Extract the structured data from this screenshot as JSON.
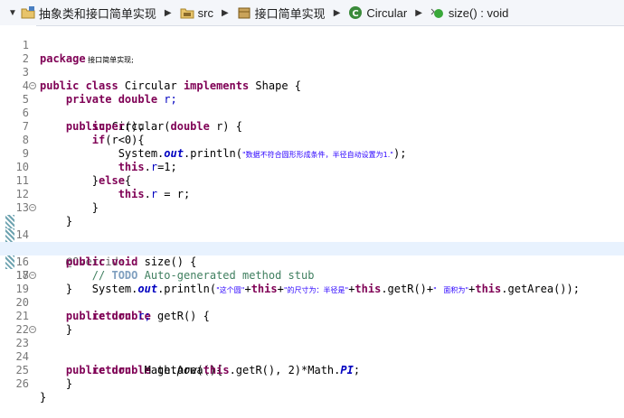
{
  "breadcrumb": {
    "items": [
      {
        "label": "抽象类和接口简单实现",
        "icon": "project-icon"
      },
      {
        "label": "src",
        "icon": "source-folder-icon"
      },
      {
        "label": "接口简单实现",
        "icon": "package-icon"
      },
      {
        "label": "Circular",
        "icon": "class-icon"
      },
      {
        "label": "size() : void",
        "icon": "method-icon"
      }
    ]
  },
  "editor": {
    "line_numbers": [
      "1",
      "2",
      "3",
      "4",
      "5",
      "6",
      "7",
      "8",
      "9",
      "10",
      "11",
      "12",
      "13",
      "14",
      "15",
      "16",
      "17",
      "18",
      "19",
      "20",
      "21",
      "22",
      "23",
      "24",
      "25",
      "26"
    ],
    "code": {
      "l1_kw": "package",
      "l1_pkg": " 接口简单实现;",
      "l3_a": "public class",
      "l3_b": " Circular ",
      "l3_c": "implements",
      "l3_d": " Shape {",
      "l4_a": "    private double",
      "l4_b": " r;",
      "l5_a": "    public",
      "l5_b": " Circular(",
      "l5_c": "double",
      "l5_d": " r) {",
      "l6_a": "        super",
      "l6_b": "();",
      "l7_a": "        if",
      "l7_b": "(r<0){",
      "l8_a": "            System.",
      "l8_b": "out",
      "l8_c": ".println(",
      "l8_d": "\"数据不符合圆形形成条件，半径自动设置为1.\"",
      "l8_e": ");",
      "l9_a": "            this",
      "l9_b": ".",
      "l9_c": "r",
      "l9_d": "=1;",
      "l10_a": "        }",
      "l10_b": "else",
      "l10_c": "{",
      "l11_a": "            this",
      "l11_b": ".",
      "l11_c": "r",
      "l11_d": " = r;",
      "l12": "        }",
      "l13": "    }",
      "l14": "    @Override",
      "l15_a": "    public void",
      "l15_b": " size() {",
      "l16_a": "        // ",
      "l16_b": "TODO",
      "l16_c": " Auto-generated method stub",
      "l17_a": "        System.",
      "l17_b": "out",
      "l17_c": ".println(",
      "l17_d": "\"这个圆\"",
      "l17_e": "+",
      "l17_f": "this",
      "l17_g": "+",
      "l17_h": "\"的尺寸为：半径是\"",
      "l17_i": "+",
      "l17_j": "this",
      "l17_k": ".getR()+",
      "l17_l": "\"   面积为\"",
      "l17_m": "+",
      "l17_n": "this",
      "l17_o": ".getArea());",
      "l18": "    }",
      "l19_a": "    public double",
      "l19_b": " getR() {",
      "l20_a": "        return",
      "l20_b": " r;",
      "l21": "    }",
      "l23_a": "    public double",
      "l23_b": " getArea(){",
      "l24_a": "        return",
      "l24_b": "  Math.",
      "l24_c": "pow",
      "l24_d": "(",
      "l24_e": "this",
      "l24_f": ".getR(), 2)*Math.",
      "l24_g": "PI",
      "l24_h": ";",
      "l25": "    }",
      "l26": "}"
    }
  },
  "colors": {
    "keyword": "#7f0055",
    "string": "#2a00ff",
    "comment": "#3f7f5f",
    "field": "#0000c0",
    "current_line": "#e8f2fe"
  }
}
